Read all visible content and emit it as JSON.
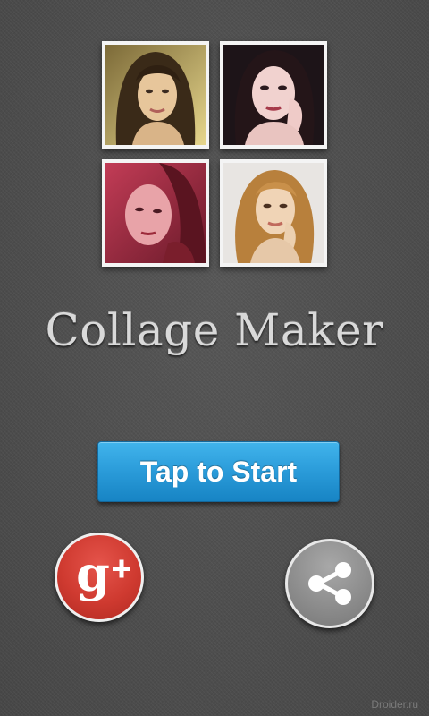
{
  "app": {
    "title": "Collage Maker",
    "start_button_label": "Tap to Start"
  },
  "photos": [
    {
      "name": "photo-1",
      "tone": "#c9b36a"
    },
    {
      "name": "photo-2",
      "tone": "#2a1c24"
    },
    {
      "name": "photo-3",
      "tone": "#b8324a"
    },
    {
      "name": "photo-4",
      "tone": "#d8d3cf"
    }
  ],
  "social": {
    "gplus_icon": "google-plus-icon",
    "gplus_color": "#cf3a30",
    "share_icon": "share-icon",
    "share_color": "#8d8d8d"
  },
  "button_color": "#2a9bd9",
  "watermark": "Droider.ru"
}
